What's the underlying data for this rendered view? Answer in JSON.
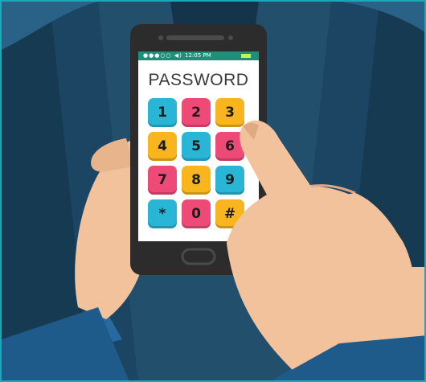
{
  "screen": {
    "title": "PASSWORD",
    "status_time": "12:05 PM",
    "status_dots": "●●●○○ ◀)"
  },
  "keypad": {
    "keys": [
      {
        "label": "1",
        "color": "#29b5d6"
      },
      {
        "label": "2",
        "color": "#ee4a78"
      },
      {
        "label": "3",
        "color": "#f8b51e"
      },
      {
        "label": "4",
        "color": "#f8b51e"
      },
      {
        "label": "5",
        "color": "#29b5d6"
      },
      {
        "label": "6",
        "color": "#ee4a78"
      },
      {
        "label": "7",
        "color": "#ee4a78"
      },
      {
        "label": "8",
        "color": "#f8b51e"
      },
      {
        "label": "9",
        "color": "#29b5d6"
      },
      {
        "label": "*",
        "color": "#29b5d6"
      },
      {
        "label": "0",
        "color": "#ee4a78"
      },
      {
        "label": "#",
        "color": "#f8b51e"
      }
    ]
  },
  "colors": {
    "background_dark": "#163a52",
    "background_light": "#1d4d6a",
    "suit": "#1e4d7a",
    "skin": "#f2c29c",
    "skin_shadow": "#e0a982",
    "phone_body": "#2c2c2c",
    "frame_border": "#1aa9b8"
  }
}
